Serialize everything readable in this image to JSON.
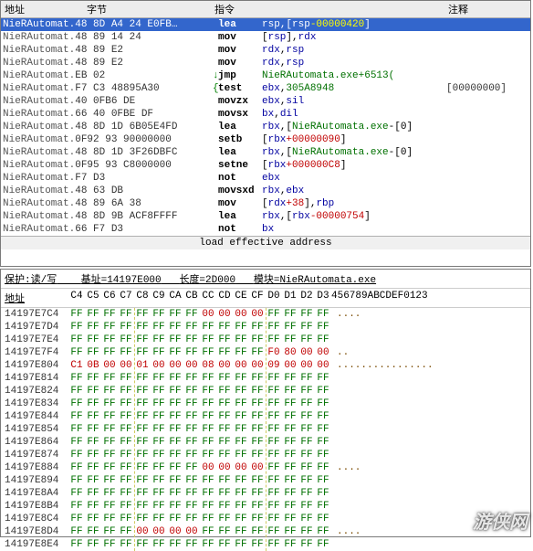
{
  "disasm": {
    "columns": {
      "addr": "地址",
      "bytes": "字节",
      "instr": "指令",
      "comment": "注释"
    },
    "status": "load effective address",
    "rows": [
      {
        "module": "NieRAutomat.",
        "addr": "48 8D A4 24 E0FB…",
        "bytes": "",
        "mnemonic": "lea",
        "operand_html": "<span class='blue'>rsp</span>,[<span class='blue'>rsp</span><span class='val-yellow red'>-00000420</span>]",
        "gutter": "",
        "comment": "",
        "selected": true
      },
      {
        "module": "NieRAutomat.",
        "addr": "48 89 14 24",
        "bytes": "",
        "mnemonic": "mov",
        "operand_html": "[<span class='blue'>rsp</span>],<span class='blue'>rdx</span>",
        "gutter": "",
        "comment": ""
      },
      {
        "module": "NieRAutomat.",
        "addr": "48 89 E2",
        "bytes": "",
        "mnemonic": "mov",
        "operand_html": "<span class='blue'>rdx</span>,<span class='blue'>rsp</span>",
        "gutter": "",
        "comment": ""
      },
      {
        "module": "NieRAutomat.",
        "addr": "48 89 E2",
        "bytes": "",
        "mnemonic": "mov",
        "operand_html": "<span class='blue'>rdx</span>,<span class='blue'>rsp</span>",
        "gutter": "",
        "comment": ""
      },
      {
        "module": "NieRAutomat.",
        "addr": "EB 02",
        "bytes": "",
        "mnemonic": "jmp",
        "operand_html": "<span class='green'>NieRAutomata.exe+6513(</span>",
        "gutter": "↓",
        "comment": ""
      },
      {
        "module": "NieRAutomat.",
        "addr": "F7 C3 48895A30",
        "bytes": "",
        "mnemonic": "test",
        "operand_html": "<span class='blue'>ebx</span>,<span class='green'>305A8948</span>",
        "gutter": "{",
        "comment": "[00000000]"
      },
      {
        "module": "NieRAutomat.",
        "addr": "40 0FB6 DE",
        "bytes": "",
        "mnemonic": "movzx",
        "operand_html": "<span class='blue'>ebx</span>,<span class='blue'>sil</span>",
        "gutter": "",
        "comment": ""
      },
      {
        "module": "NieRAutomat.",
        "addr": "66 40 0FBE DF",
        "bytes": "",
        "mnemonic": "movsx",
        "operand_html": "<span class='blue'>bx</span>,<span class='blue'>dil</span>",
        "gutter": "",
        "comment": ""
      },
      {
        "module": "NieRAutomat.",
        "addr": "48 8D 1D 6B05E4FD",
        "bytes": "",
        "mnemonic": "lea",
        "operand_html": "<span class='blue'>rbx</span>,[<span class='green'>NieRAutomata.exe</span>-[0]",
        "gutter": "",
        "comment": ""
      },
      {
        "module": "NieRAutomat.",
        "addr": "0F92 93 90000000",
        "bytes": "",
        "mnemonic": "setb",
        "operand_html": "[<span class='blue'>rbx</span><span class='red'>+00000090</span>]",
        "gutter": "",
        "comment": ""
      },
      {
        "module": "NieRAutomat.",
        "addr": "48 8D 1D 3F26DBFC",
        "bytes": "",
        "mnemonic": "lea",
        "operand_html": "<span class='blue'>rbx</span>,[<span class='green'>NieRAutomata.exe</span>-[0]",
        "gutter": "",
        "comment": ""
      },
      {
        "module": "NieRAutomat.",
        "addr": "0F95 93 C8000000",
        "bytes": "",
        "mnemonic": "setne",
        "operand_html": "[<span class='blue'>rbx</span><span class='red'>+000000C8</span>]",
        "gutter": "",
        "comment": ""
      },
      {
        "module": "NieRAutomat.",
        "addr": "F7 D3",
        "bytes": "",
        "mnemonic": "not",
        "operand_html": "<span class='blue'>ebx</span>",
        "gutter": "",
        "comment": ""
      },
      {
        "module": "NieRAutomat.",
        "addr": "48 63 DB",
        "bytes": "",
        "mnemonic": "movsxd",
        "operand_html": " <span class='blue'>rbx</span>,<span class='blue'>ebx</span>",
        "gutter": "",
        "comment": ""
      },
      {
        "module": "NieRAutomat.",
        "addr": "48 89 6A 38",
        "bytes": "",
        "mnemonic": "mov",
        "operand_html": "[<span class='blue'>rdx</span><span class='red'>+38</span>],<span class='blue'>rbp</span>",
        "gutter": "",
        "comment": ""
      },
      {
        "module": "NieRAutomat.",
        "addr": "48 8D 9B ACF8FFFF",
        "bytes": "",
        "mnemonic": "lea",
        "operand_html": "<span class='blue'>rbx</span>,[<span class='blue'>rbx</span><span class='red'>-00000754</span>]",
        "gutter": "",
        "comment": ""
      },
      {
        "module": "NieRAutomat.",
        "addr": "66 F7 D3",
        "bytes": "",
        "mnemonic": "not",
        "operand_html": "<span class='blue'>bx</span>",
        "gutter": "",
        "comment": ""
      }
    ]
  },
  "dump": {
    "info_label_protect": "保护:读/写",
    "info_label_base": "基址=14197E000",
    "info_label_len": "长度=2D000",
    "info_label_module": "模块=NieRAutomata.exe",
    "addr_label": "地址",
    "byte_headers": [
      "C4",
      "C5",
      "C6",
      "C7",
      "C8",
      "C9",
      "CA",
      "CB",
      "CC",
      "CD",
      "CE",
      "CF",
      "D0",
      "D1",
      "D2",
      "D3"
    ],
    "ascii_header": "456789ABCDEF0123",
    "vsep_cols": [
      4,
      12
    ],
    "rows": [
      {
        "addr": "14197E7C4",
        "bytes": [
          "FF",
          "FF",
          "FF",
          "FF",
          "FF",
          "FF",
          "FF",
          "FF",
          "00",
          "00",
          "00",
          "00",
          "FF",
          "FF",
          "FF",
          "FF"
        ],
        "ascii": "        ....    "
      },
      {
        "addr": "14197E7D4",
        "bytes": [
          "FF",
          "FF",
          "FF",
          "FF",
          "FF",
          "FF",
          "FF",
          "FF",
          "FF",
          "FF",
          "FF",
          "FF",
          "FF",
          "FF",
          "FF",
          "FF"
        ],
        "ascii": ""
      },
      {
        "addr": "14197E7E4",
        "bytes": [
          "FF",
          "FF",
          "FF",
          "FF",
          "FF",
          "FF",
          "FF",
          "FF",
          "FF",
          "FF",
          "FF",
          "FF",
          "FF",
          "FF",
          "FF",
          "FF"
        ],
        "ascii": ""
      },
      {
        "addr": "14197E7F4",
        "bytes": [
          "FF",
          "FF",
          "FF",
          "FF",
          "FF",
          "FF",
          "FF",
          "FF",
          "FF",
          "FF",
          "FF",
          "FF",
          "F0",
          "80",
          "00",
          "00"
        ],
        "ascii": "              .."
      },
      {
        "addr": "14197E804",
        "bytes": [
          "C1",
          "0B",
          "00",
          "00",
          "01",
          "00",
          "00",
          "00",
          "08",
          "00",
          "00",
          "00",
          "09",
          "00",
          "00",
          "00"
        ],
        "ascii": "................"
      },
      {
        "addr": "14197E814",
        "bytes": [
          "FF",
          "FF",
          "FF",
          "FF",
          "FF",
          "FF",
          "FF",
          "FF",
          "FF",
          "FF",
          "FF",
          "FF",
          "FF",
          "FF",
          "FF",
          "FF"
        ],
        "ascii": ""
      },
      {
        "addr": "14197E824",
        "bytes": [
          "FF",
          "FF",
          "FF",
          "FF",
          "FF",
          "FF",
          "FF",
          "FF",
          "FF",
          "FF",
          "FF",
          "FF",
          "FF",
          "FF",
          "FF",
          "FF"
        ],
        "ascii": ""
      },
      {
        "addr": "14197E834",
        "bytes": [
          "FF",
          "FF",
          "FF",
          "FF",
          "FF",
          "FF",
          "FF",
          "FF",
          "FF",
          "FF",
          "FF",
          "FF",
          "FF",
          "FF",
          "FF",
          "FF"
        ],
        "ascii": ""
      },
      {
        "addr": "14197E844",
        "bytes": [
          "FF",
          "FF",
          "FF",
          "FF",
          "FF",
          "FF",
          "FF",
          "FF",
          "FF",
          "FF",
          "FF",
          "FF",
          "FF",
          "FF",
          "FF",
          "FF"
        ],
        "ascii": ""
      },
      {
        "addr": "14197E854",
        "bytes": [
          "FF",
          "FF",
          "FF",
          "FF",
          "FF",
          "FF",
          "FF",
          "FF",
          "FF",
          "FF",
          "FF",
          "FF",
          "FF",
          "FF",
          "FF",
          "FF"
        ],
        "ascii": ""
      },
      {
        "addr": "14197E864",
        "bytes": [
          "FF",
          "FF",
          "FF",
          "FF",
          "FF",
          "FF",
          "FF",
          "FF",
          "FF",
          "FF",
          "FF",
          "FF",
          "FF",
          "FF",
          "FF",
          "FF"
        ],
        "ascii": ""
      },
      {
        "addr": "14197E874",
        "bytes": [
          "FF",
          "FF",
          "FF",
          "FF",
          "FF",
          "FF",
          "FF",
          "FF",
          "FF",
          "FF",
          "FF",
          "FF",
          "FF",
          "FF",
          "FF",
          "FF"
        ],
        "ascii": ""
      },
      {
        "addr": "14197E884",
        "bytes": [
          "FF",
          "FF",
          "FF",
          "FF",
          "FF",
          "FF",
          "FF",
          "FF",
          "00",
          "00",
          "00",
          "00",
          "FF",
          "FF",
          "FF",
          "FF"
        ],
        "ascii": "        ....    "
      },
      {
        "addr": "14197E894",
        "bytes": [
          "FF",
          "FF",
          "FF",
          "FF",
          "FF",
          "FF",
          "FF",
          "FF",
          "FF",
          "FF",
          "FF",
          "FF",
          "FF",
          "FF",
          "FF",
          "FF"
        ],
        "ascii": ""
      },
      {
        "addr": "14197E8A4",
        "bytes": [
          "FF",
          "FF",
          "FF",
          "FF",
          "FF",
          "FF",
          "FF",
          "FF",
          "FF",
          "FF",
          "FF",
          "FF",
          "FF",
          "FF",
          "FF",
          "FF"
        ],
        "ascii": ""
      },
      {
        "addr": "14197E8B4",
        "bytes": [
          "FF",
          "FF",
          "FF",
          "FF",
          "FF",
          "FF",
          "FF",
          "FF",
          "FF",
          "FF",
          "FF",
          "FF",
          "FF",
          "FF",
          "FF",
          "FF"
        ],
        "ascii": ""
      },
      {
        "addr": "14197E8C4",
        "bytes": [
          "FF",
          "FF",
          "FF",
          "FF",
          "FF",
          "FF",
          "FF",
          "FF",
          "FF",
          "FF",
          "FF",
          "FF",
          "FF",
          "FF",
          "FF",
          "FF"
        ],
        "ascii": ""
      },
      {
        "addr": "14197E8D4",
        "bytes": [
          "FF",
          "FF",
          "FF",
          "FF",
          "00",
          "00",
          "00",
          "00",
          "FF",
          "FF",
          "FF",
          "FF",
          "FF",
          "FF",
          "FF",
          "FF"
        ],
        "ascii": "    ....        "
      },
      {
        "addr": "14197E8E4",
        "bytes": [
          "FF",
          "FF",
          "FF",
          "FF",
          "FF",
          "FF",
          "FF",
          "FF",
          "FF",
          "FF",
          "FF",
          "FF",
          "FF",
          "FF",
          "FF",
          "FF"
        ],
        "ascii": ""
      }
    ]
  },
  "watermark": "游侠网"
}
